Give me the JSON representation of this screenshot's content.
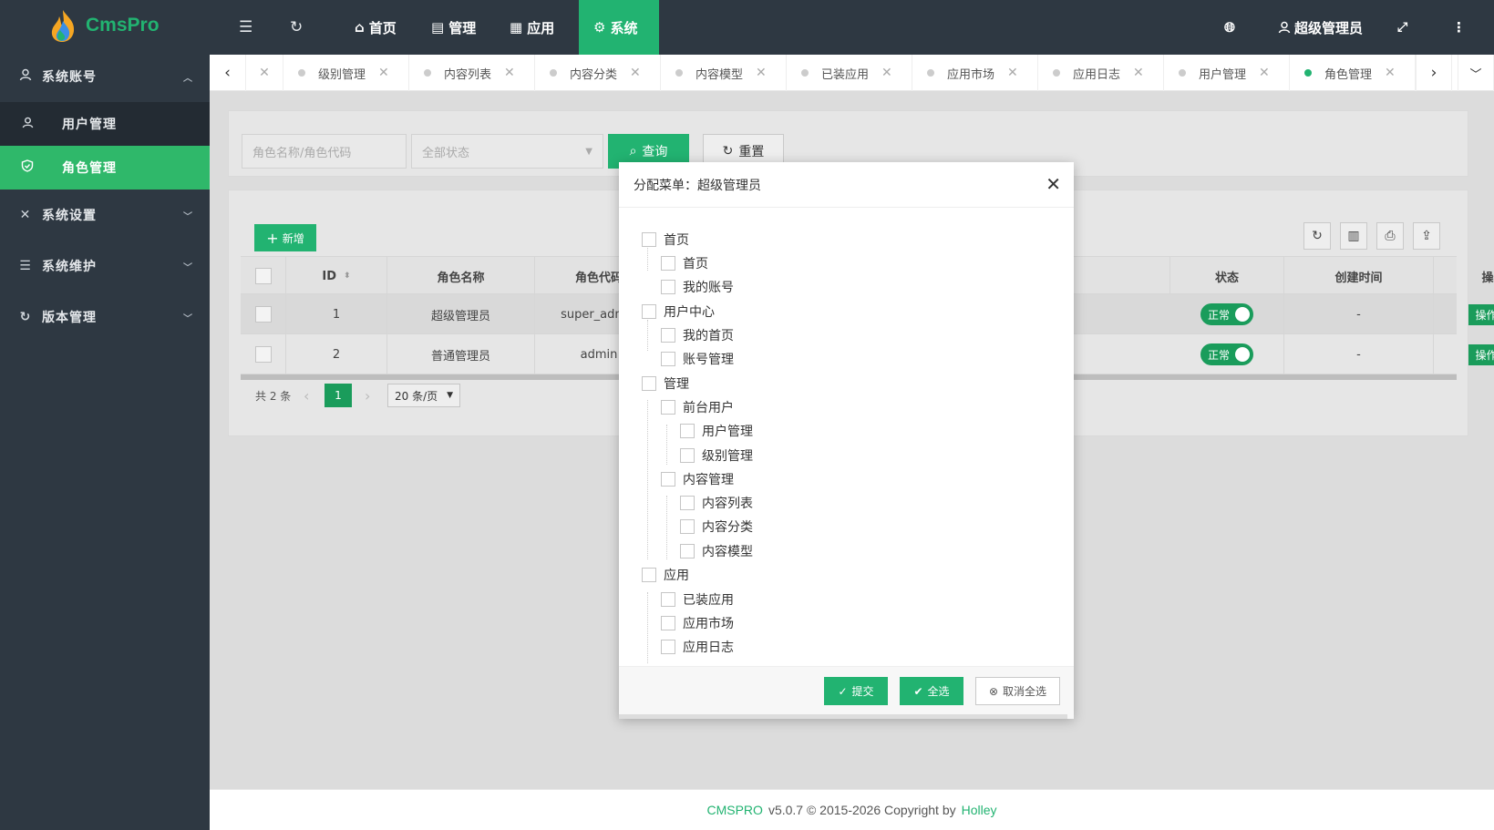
{
  "app": {
    "logo_text": "CmsPro"
  },
  "sidebar": {
    "groups": [
      {
        "label": "系统账号",
        "icon": "user-icon",
        "expanded": true,
        "items": [
          {
            "label": "用户管理",
            "icon": "user-icon"
          },
          {
            "label": "角色管理",
            "icon": "shield-check-icon",
            "active": true
          }
        ]
      },
      {
        "label": "系统设置",
        "icon": "tools-icon"
      },
      {
        "label": "系统维护",
        "icon": "server-icon"
      },
      {
        "label": "版本管理",
        "icon": "refresh-icon"
      }
    ]
  },
  "header": {
    "tabs": [
      {
        "label": "首页",
        "icon": "home-icon"
      },
      {
        "label": "管理",
        "icon": "calendar-icon"
      },
      {
        "label": "应用",
        "icon": "apps-icon"
      },
      {
        "label": "系统",
        "icon": "gear-icon",
        "active": true
      }
    ],
    "user": "超级管理员"
  },
  "tabbar": {
    "items": [
      {
        "label": "级别管理"
      },
      {
        "label": "内容列表"
      },
      {
        "label": "内容分类"
      },
      {
        "label": "内容模型"
      },
      {
        "label": "已装应用"
      },
      {
        "label": "应用市场"
      },
      {
        "label": "应用日志"
      },
      {
        "label": "用户管理"
      },
      {
        "label": "角色管理",
        "active": true
      }
    ]
  },
  "search": {
    "keyword_placeholder": "角色名称/角色代码",
    "status_placeholder": "全部状态",
    "query_label": "查询",
    "reset_label": "重置"
  },
  "table": {
    "add_label": "新增",
    "columns": {
      "id": "ID",
      "name": "角色名称",
      "code": "角色代码",
      "status": "状态",
      "created": "创建时间",
      "ops": "操作"
    },
    "rows": [
      {
        "id": "1",
        "name": "超级管理员",
        "code": "super_admin",
        "status": "正常",
        "created": "-",
        "op": "操作"
      },
      {
        "id": "2",
        "name": "普通管理员",
        "code": "admin",
        "status": "正常",
        "created": "-",
        "op": "操作"
      }
    ],
    "pager": {
      "total": "共 2 条",
      "page": "1",
      "size": "20 条/页"
    }
  },
  "modal": {
    "title": "分配菜单：超级管理员",
    "tree": [
      {
        "label": "首页",
        "level": 0
      },
      {
        "label": "首页",
        "level": 1
      },
      {
        "label": "我的账号",
        "level": 1
      },
      {
        "label": "用户中心",
        "level": 0
      },
      {
        "label": "我的首页",
        "level": 1
      },
      {
        "label": "账号管理",
        "level": 1
      },
      {
        "label": "管理",
        "level": 0
      },
      {
        "label": "前台用户",
        "level": 1
      },
      {
        "label": "用户管理",
        "level": 2
      },
      {
        "label": "级别管理",
        "level": 2
      },
      {
        "label": "内容管理",
        "level": 1
      },
      {
        "label": "内容列表",
        "level": 2
      },
      {
        "label": "内容分类",
        "level": 2
      },
      {
        "label": "内容模型",
        "level": 2
      },
      {
        "label": "应用",
        "level": 0
      },
      {
        "label": "已装应用",
        "level": 1
      },
      {
        "label": "应用市场",
        "level": 1
      },
      {
        "label": "应用日志",
        "level": 1
      }
    ],
    "submit_label": "提交",
    "select_all_label": "全选",
    "deselect_label": "取消全选"
  },
  "footer": {
    "brand": "CMSPRO",
    "text": "v5.0.7 © 2015-2026 Copyright by",
    "author": "Holley"
  },
  "colors": {
    "accent": "#22b371",
    "sidebar_bg": "#2e3842"
  }
}
